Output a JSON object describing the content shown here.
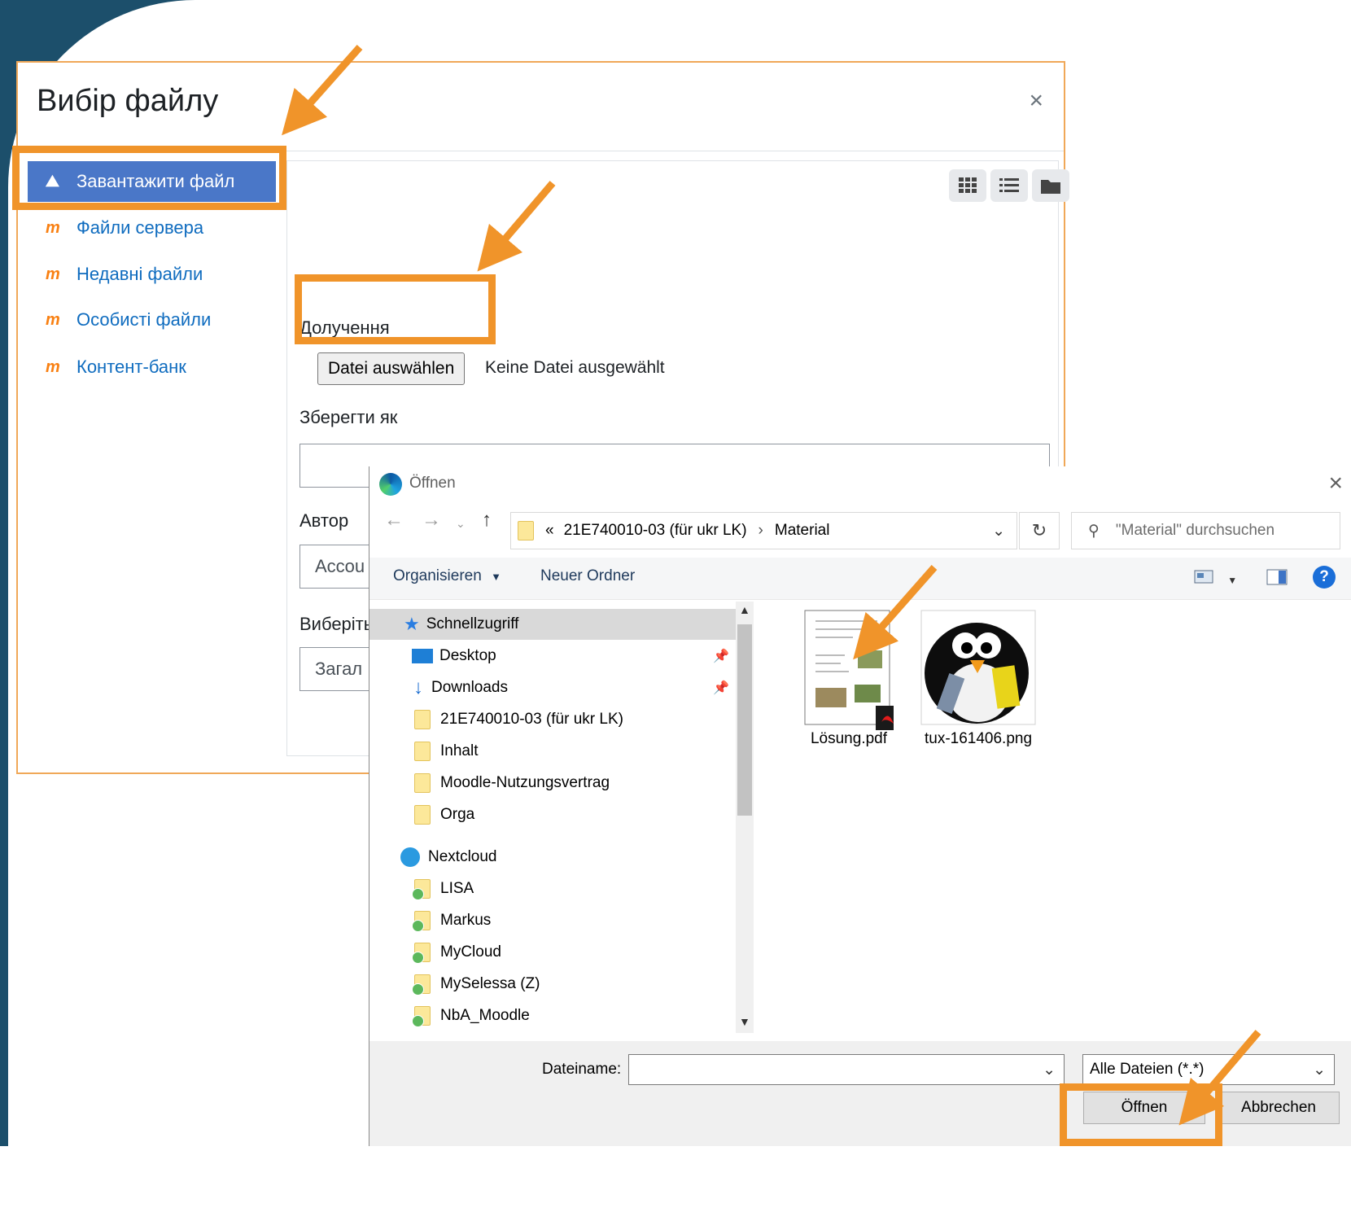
{
  "picker": {
    "title": "Вибір файлу",
    "close": "×",
    "sidebar": [
      {
        "label": "Завантажити файл",
        "icon": "upload-icon",
        "active": true
      },
      {
        "label": "Файли сервера",
        "icon": "moodle-icon"
      },
      {
        "label": "Недавні файли",
        "icon": "moodle-icon"
      },
      {
        "label": "Особисті файли",
        "icon": "moodle-icon"
      },
      {
        "label": "Контент-банк",
        "icon": "moodle-icon"
      }
    ],
    "attachment_label": "Долучення",
    "choose_file_button": "Datei auswählen",
    "no_file_text": "Keine Datei ausgewählt",
    "save_as_label": "Зберегти як",
    "save_as_value": "",
    "author_label": "Автор",
    "author_value": "Accou",
    "license_label": "Виберіть",
    "license_value": "Загал"
  },
  "dialog": {
    "title": "Öffnen",
    "close": "×",
    "path": [
      "21E740010-03 (für ukr LK)",
      "Material"
    ],
    "path_prefix": "«",
    "search_placeholder": "\"Material\" durchsuchen",
    "toolbar": {
      "organize": "Organisieren",
      "new_folder": "Neuer Ordner",
      "help": "?"
    },
    "tree": [
      {
        "label": "Schnellzugriff",
        "icon": "star-icon",
        "selected": true
      },
      {
        "label": "Desktop",
        "icon": "desktop-icon",
        "pinned": true
      },
      {
        "label": "Downloads",
        "icon": "download-icon",
        "pinned": true
      },
      {
        "label": "21E740010-03 (für ukr LK)",
        "icon": "folder-icon"
      },
      {
        "label": "Inhalt",
        "icon": "folder-icon"
      },
      {
        "label": "Moodle-Nutzungsvertrag",
        "icon": "folder-icon"
      },
      {
        "label": "Orga",
        "icon": "folder-icon"
      },
      {
        "label": "Nextcloud",
        "icon": "nextcloud-icon"
      },
      {
        "label": "LISA",
        "icon": "cloud-folder-icon"
      },
      {
        "label": "Markus",
        "icon": "cloud-folder-icon"
      },
      {
        "label": "MyCloud",
        "icon": "cloud-folder-icon"
      },
      {
        "label": "MySelessa (Z)",
        "icon": "cloud-folder-icon"
      },
      {
        "label": "NbA_Moodle",
        "icon": "cloud-folder-icon"
      }
    ],
    "files": [
      {
        "name": "Lösung.pdf",
        "icon": "pdf-thumbnail-icon"
      },
      {
        "name": "tux-161406.png",
        "icon": "penguin-thumbnail-icon"
      }
    ],
    "filename_label": "Dateiname:",
    "filename_value": "",
    "filter_value": "Alle Dateien (*.*)",
    "open_button": "Öffnen",
    "cancel_button": "Abbrechen"
  },
  "colors": {
    "highlight": "#f0942a",
    "moodle_blue": "#0f6cbf",
    "active_bg": "#4a77c8",
    "moodle_orange": "#f98012"
  }
}
